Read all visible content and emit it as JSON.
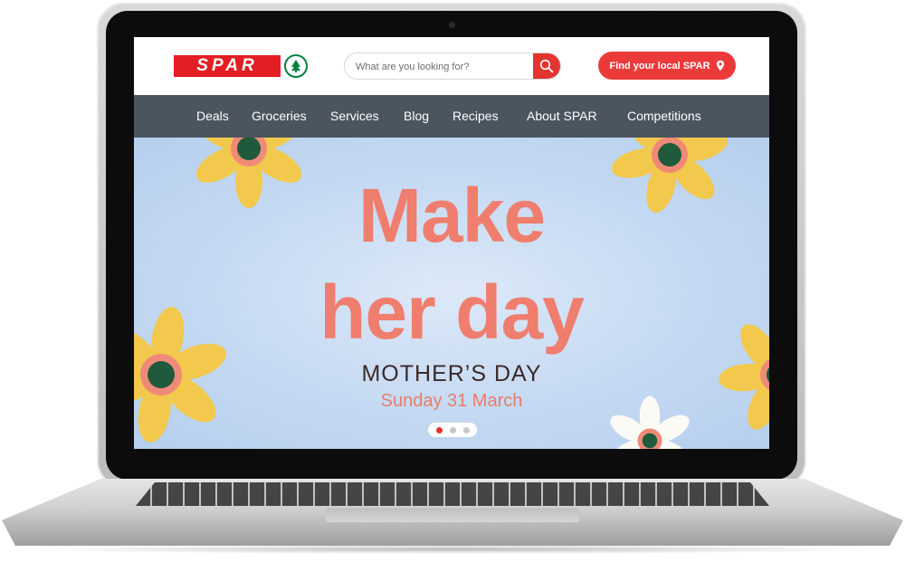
{
  "brand": {
    "logo_text": "SPAR",
    "color": "#e31e24",
    "tree_color": "#00813f"
  },
  "search": {
    "placeholder": "What are you looking for?",
    "value": "",
    "icon": "search-icon"
  },
  "header": {
    "find_store_label": "Find your local SPAR",
    "find_store_icon": "location-pin-icon"
  },
  "nav": {
    "items": [
      {
        "label": "Deals"
      },
      {
        "label": "Groceries"
      },
      {
        "label": "Services"
      },
      {
        "label": "Blog"
      },
      {
        "label": "Recipes"
      },
      {
        "label": "About SPAR"
      },
      {
        "label": "Competitions"
      }
    ],
    "background": "#4b5560"
  },
  "hero": {
    "headline_line1": "Make",
    "headline_line2": "her day",
    "occasion": "MOTHER’S DAY",
    "date": "Sunday 31 March",
    "slides_total": 3,
    "active_slide": 1,
    "colors": {
      "headline": "#f07e6e",
      "background": "#c4d9f2",
      "petal": "#f2c94c"
    }
  }
}
